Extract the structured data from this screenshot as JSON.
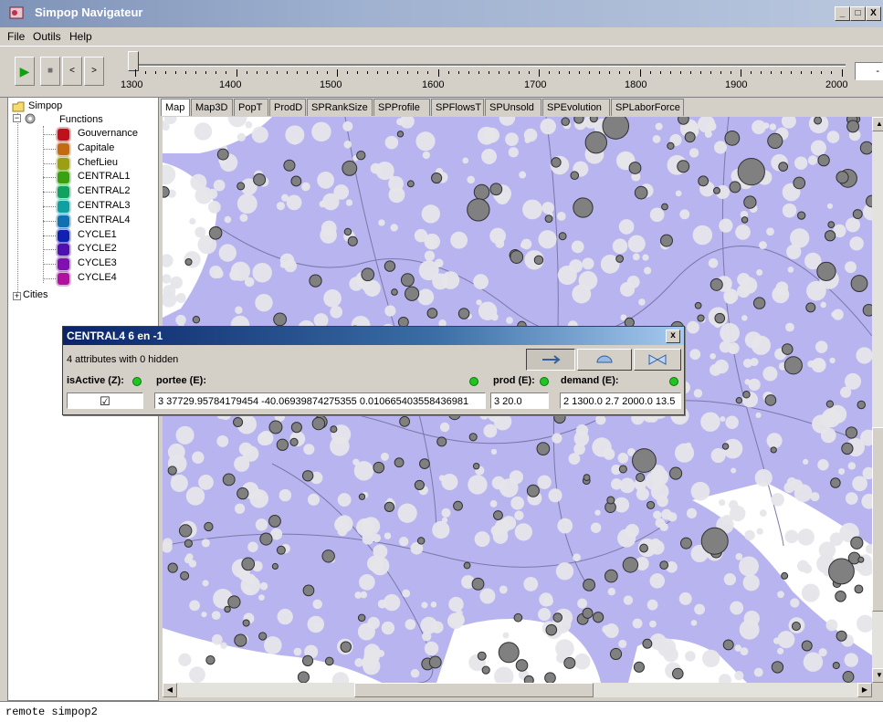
{
  "window": {
    "title": "Simpop Navigateur",
    "buttons": [
      "_",
      "□",
      "X"
    ]
  },
  "menu": {
    "items": [
      "File",
      "Outils",
      "Help"
    ]
  },
  "toolbar": {
    "play": "▶",
    "stop": "■",
    "prev": "<",
    "next": ">",
    "time_labels": [
      "1300",
      "1400",
      "1500",
      "1600",
      "1700",
      "1800",
      "1900",
      "2000"
    ],
    "current_value_partial": "-"
  },
  "tree": {
    "root": "Simpop",
    "functions": "Functions",
    "items": [
      {
        "label": "Gouvernance",
        "color": "#c0101a"
      },
      {
        "label": "Capitale",
        "color": "#c46a10"
      },
      {
        "label": "ChefLieu",
        "color": "#9aa010"
      },
      {
        "label": "CENTRAL1",
        "color": "#3aa010"
      },
      {
        "label": "CENTRAL2",
        "color": "#10a060"
      },
      {
        "label": "CENTRAL3",
        "color": "#10a0a0"
      },
      {
        "label": "CENTRAL4",
        "color": "#1070b0"
      },
      {
        "label": "CYCLE1",
        "color": "#1020b0"
      },
      {
        "label": "CYCLE2",
        "color": "#5010b0"
      },
      {
        "label": "CYCLE3",
        "color": "#8010b0"
      },
      {
        "label": "CYCLE4",
        "color": "#b010a0"
      }
    ],
    "cities": "Cities"
  },
  "tabs": [
    "Map",
    "Map3D",
    "PopT",
    "ProdD",
    "SPRankSize",
    "SPProfile",
    "SPFlowsT",
    "SPUnsold",
    "SPEvolution",
    "SPLaborForce"
  ],
  "dialog": {
    "title": "CENTRAL4 6 en -1",
    "close": "x",
    "attributes_summary": "4 attributes with 0 hidden",
    "columns": [
      {
        "header": "isActive (Z):",
        "value": "☑"
      },
      {
        "header": "portee (E):",
        "value": "3 37729.95784179454 -40.06939874275355 0.010665403558436981"
      },
      {
        "header": "prod (E):",
        "value": "3 20.0"
      },
      {
        "header": "demand (E):",
        "value": "2 1300.0 2.7 2000.0 13.5"
      }
    ],
    "led_color": "#22c322"
  },
  "status": {
    "text": "remote simpop2"
  },
  "colors": {
    "sea": "#ffffff",
    "land": "#b8b4f0",
    "city_dark": "#808080",
    "city_light": "#e6e6ea"
  }
}
